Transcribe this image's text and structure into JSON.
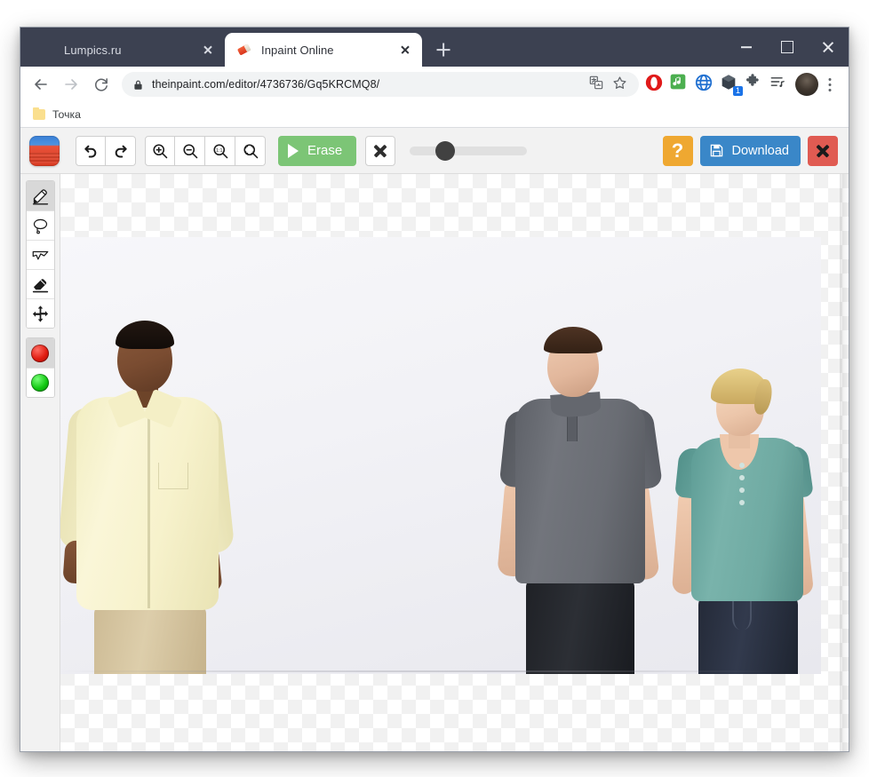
{
  "window": {
    "controls": {
      "minimize": "minimize",
      "maximize": "maximize",
      "close": "close"
    }
  },
  "tabs": [
    {
      "title": "Lumpics.ru",
      "favicon": "orange-slice-icon",
      "active": false,
      "close_label": "close-tab"
    },
    {
      "title": "Inpaint Online",
      "favicon": "eraser-icon",
      "active": true,
      "close_label": "close-tab"
    }
  ],
  "new_tab_label": "+",
  "navigation": {
    "back": "back-arrow",
    "forward": "forward-arrow",
    "reload": "reload-arrow",
    "url_secure_label": "lock-icon",
    "url": "theinpaint.com/editor/4736736/Gq5KRCMQ8/",
    "url_host": "theinpaint.com",
    "url_path": "/editor/4736736/Gq5KRCMQ8/",
    "translate": "translate-icon",
    "bookmark_star": "star-icon",
    "extensions": [
      {
        "name": "opera-icon",
        "badge": ""
      },
      {
        "name": "music-note-icon",
        "badge": ""
      },
      {
        "name": "globe-icon",
        "badge": ""
      },
      {
        "name": "cube-icon",
        "badge": "1"
      },
      {
        "name": "puzzle-piece-icon",
        "badge": ""
      },
      {
        "name": "playlist-icon",
        "badge": ""
      }
    ],
    "profile": "avatar-icon",
    "menu": "three-dot-menu-icon"
  },
  "bookmarks": [
    {
      "label": "Точка",
      "icon": "folder-icon"
    }
  ],
  "app": {
    "logo": "inpaint-logo-icon",
    "toolbar": {
      "undo": "undo-icon",
      "redo": "redo-icon",
      "zoom_in": "zoom-in-icon",
      "zoom_out": "zoom-out-icon",
      "zoom_actual": "zoom-1-1-icon",
      "zoom_fit": "zoom-fit-icon",
      "erase_label": "Erase",
      "clear_selection": "clear-x-icon",
      "brush_size_percent": 30,
      "help_label": "?",
      "download_label": "Download",
      "close_editor": "close-x-icon"
    },
    "tools": [
      {
        "name": "marker-tool",
        "icon": "marker-icon",
        "active": true
      },
      {
        "name": "lasso-tool",
        "icon": "lasso-icon",
        "active": false
      },
      {
        "name": "polygon-lasso-tool",
        "icon": "polygon-lasso-icon",
        "active": false
      },
      {
        "name": "eraser-tool",
        "icon": "eraser-icon",
        "active": false
      },
      {
        "name": "move-tool",
        "icon": "move-arrows-icon",
        "active": false
      }
    ],
    "colors": [
      {
        "name": "red-marker-color",
        "hex": "#e01c10",
        "active": true
      },
      {
        "name": "green-marker-color",
        "hex": "#12c812",
        "active": false
      }
    ],
    "canvas": {
      "transparent_background": "checkerboard",
      "photo_alt": "Three people standing against a white studio background",
      "people": [
        {
          "name": "man-yellow-shirt",
          "shirt_hex": "#f7f2cc",
          "pants_hex": "#ddceab"
        },
        {
          "name": "man-grey-polo",
          "shirt_hex": "#6a6d74",
          "pants_hex": "#2c2f35"
        },
        {
          "name": "woman-teal-top",
          "shirt_hex": "#6faaa2",
          "pants_hex": "#323a4d"
        }
      ]
    }
  },
  "colors": {
    "tabstrip_bg": "#3c4151",
    "erase_green": "#7cc576",
    "download_blue": "#3a87c8",
    "help_orange": "#efa831",
    "close_red": "#e05b52"
  }
}
